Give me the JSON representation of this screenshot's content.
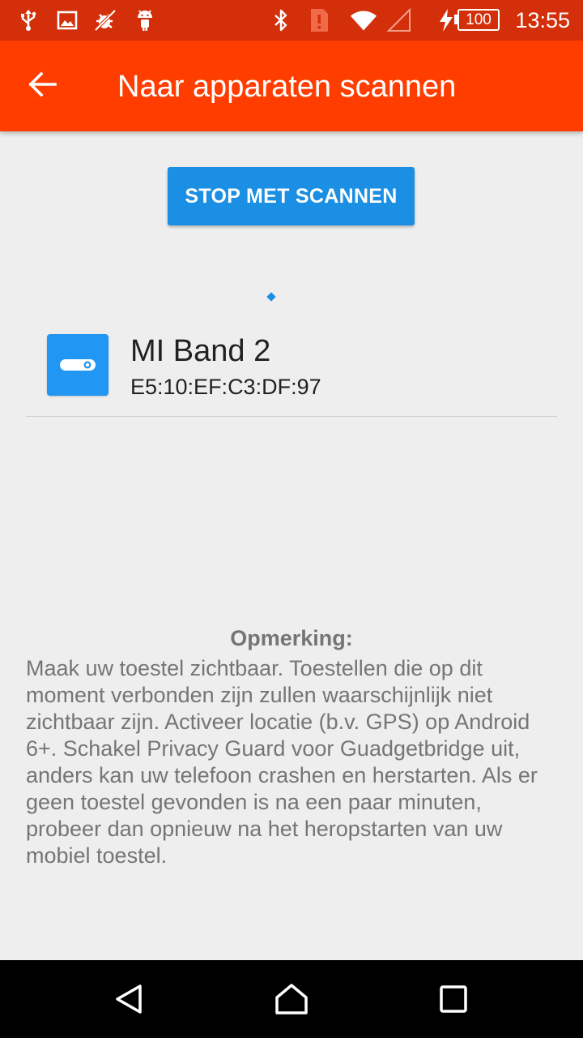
{
  "status_bar": {
    "time": "13:55",
    "battery": "100",
    "icons": [
      "usb-icon",
      "image-icon",
      "debug-icon",
      "android-icon",
      "bluetooth-icon",
      "sim-alert-icon",
      "wifi-icon",
      "signal-icon",
      "charging-icon"
    ],
    "color": "#d32f0a"
  },
  "app_bar": {
    "title": "Naar apparaten scannen",
    "back_icon": "arrow-back-icon",
    "color": "#ff3d00"
  },
  "actions": {
    "stop_label": "STOP MET SCANNEN",
    "button_color": "#1a8fe3"
  },
  "devices": [
    {
      "name": "MI Band 2",
      "address": "E5:10:EF:C3:DF:97",
      "icon": "fitness-band-icon"
    }
  ],
  "note": {
    "heading": "Opmerking:",
    "body": "Maak uw toestel zichtbaar. Toestellen die op dit moment verbonden zijn zullen waarschijnlijk niet zichtbaar zijn. Activeer locatie (b.v. GPS) op Android 6+. Schakel Privacy Guard voor Guadgetbridge uit, anders kan uw telefoon crashen en herstarten. Als er geen toestel gevonden is na een paar minuten, probeer dan opnieuw na het heropstarten van uw mobiel toestel."
  },
  "nav_bar": {
    "buttons": [
      "back-triangle-icon",
      "home-icon",
      "recents-icon"
    ]
  }
}
